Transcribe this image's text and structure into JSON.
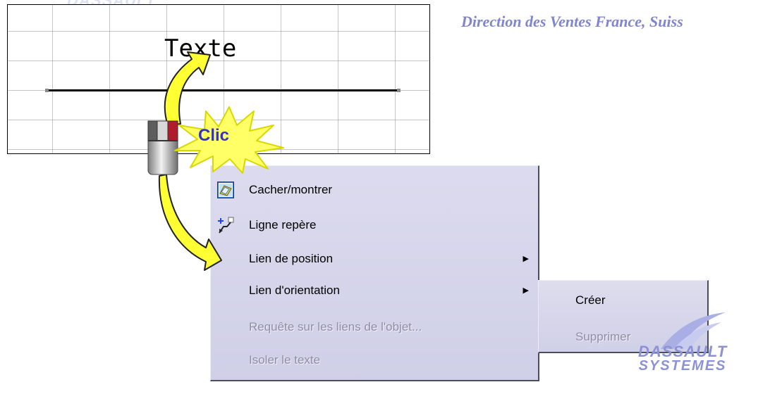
{
  "header": {
    "title": "Direction des Ventes France, Suiss"
  },
  "top_logo_text": "DASSAULT",
  "drawing": {
    "text": "Texte"
  },
  "callout": {
    "label": "Clic"
  },
  "context_menu": {
    "items": [
      {
        "label": "Cacher/montrer",
        "disabled": false,
        "icon": "hide-show-icon",
        "submenu": false
      },
      {
        "label": "Ligne repère",
        "disabled": false,
        "icon": "leader-line-icon",
        "submenu": false
      },
      {
        "label": "Lien de position",
        "disabled": false,
        "submenu": true
      },
      {
        "label": "Lien d'orientation",
        "disabled": false,
        "submenu": true
      },
      {
        "label": "Requête sur les liens de l'objet...",
        "disabled": true,
        "submenu": false
      },
      {
        "label": "Isoler le texte",
        "disabled": true,
        "submenu": false
      }
    ],
    "submenu_arrow": "▶"
  },
  "submenu": {
    "items": [
      {
        "label": "Créer",
        "disabled": false
      },
      {
        "label": "Supprimer",
        "disabled": true
      }
    ]
  },
  "logo": {
    "line1": "DASSAULT",
    "line2": "SYSTEMES"
  },
  "colors": {
    "accent_text": "#7f85cf",
    "arrow_yellow": "#ffff33",
    "burst_yellow": "#ffff66",
    "callout_text": "#3333cc",
    "menu_bg": "#d6d6ec"
  }
}
